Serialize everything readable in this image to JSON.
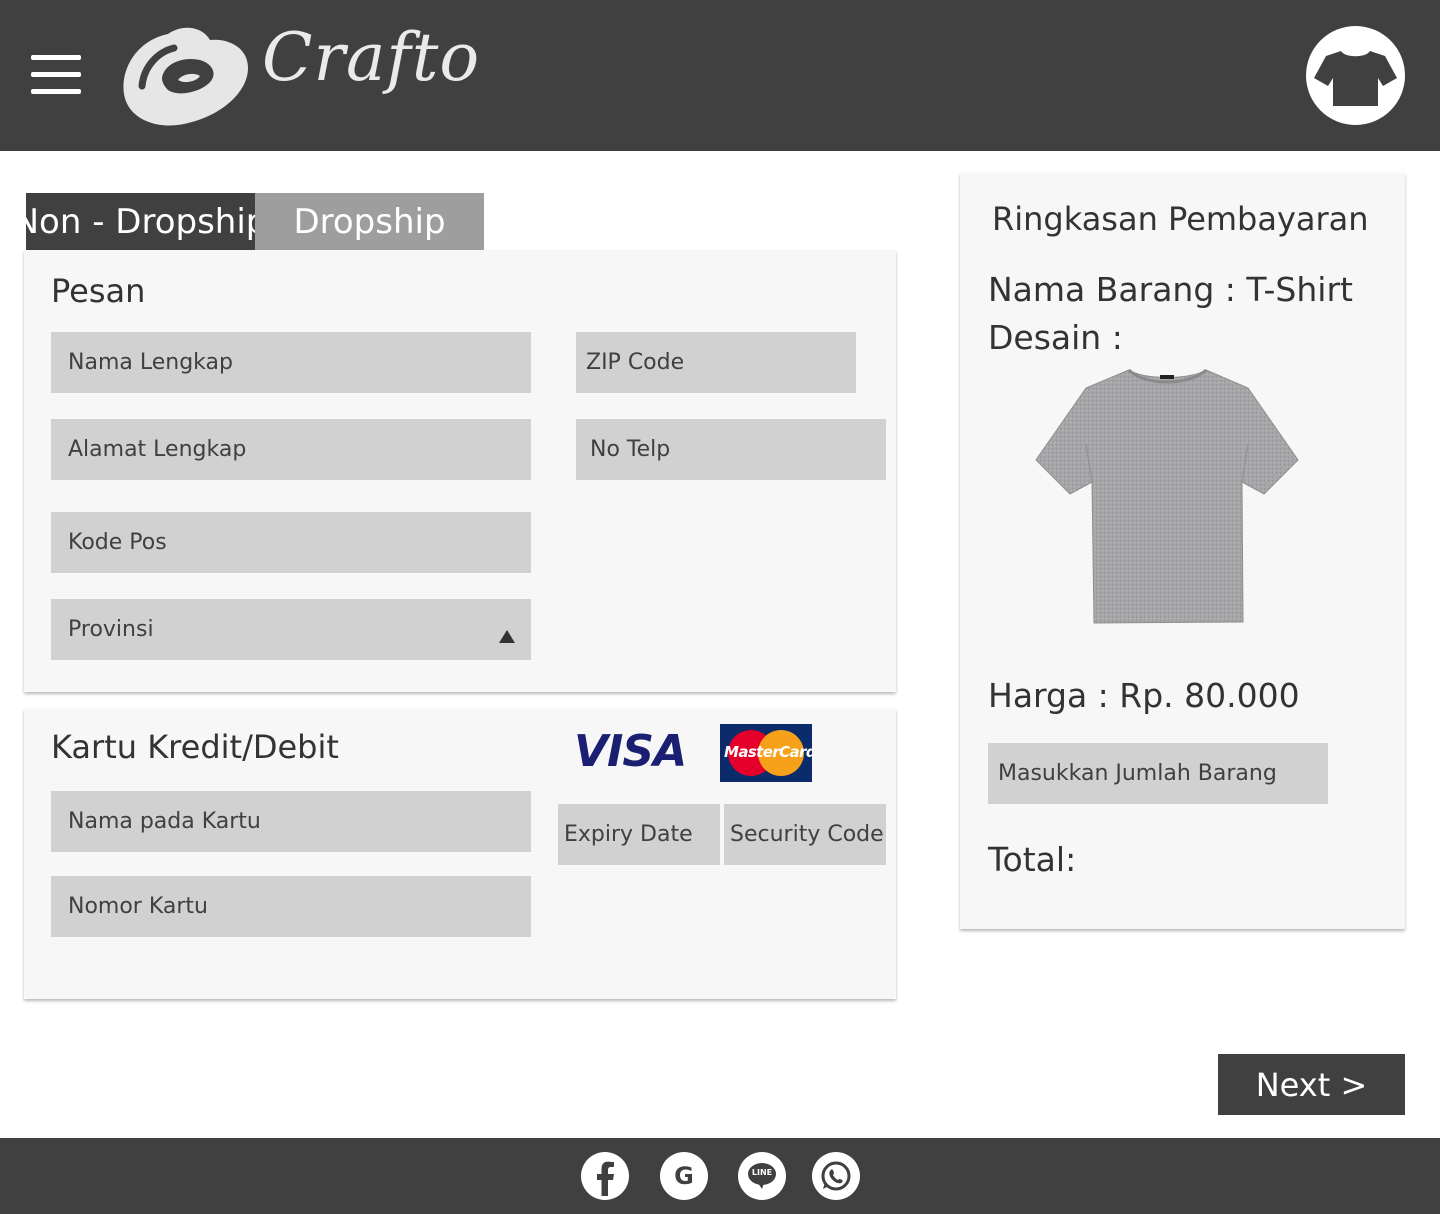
{
  "header": {
    "brand": "Crafto",
    "menu_icon": "hamburger-menu-icon",
    "account_icon": "tshirt-icon"
  },
  "tabs": [
    {
      "label": "Non - Dropship",
      "active": true
    },
    {
      "label": "Dropship",
      "active": false
    }
  ],
  "pesan": {
    "title": "Pesan",
    "fields": {
      "nama_lengkap": "Nama Lengkap",
      "zip_code": "ZIP Code",
      "alamat_lengkap": "Alamat Lengkap",
      "no_telp": "No Telp",
      "kode_pos": "Kode Pos",
      "provinsi": "Provinsi"
    }
  },
  "kartu": {
    "title": "Kartu Kredit/Debit",
    "brands": {
      "visa": "VISA",
      "mastercard": "MasterCard"
    },
    "fields": {
      "nama_pada_kartu": "Nama pada Kartu",
      "nomor_kartu": "Nomor Kartu",
      "expiry_date": "Expiry Date",
      "security_code": "Security Code"
    }
  },
  "summary": {
    "title": "Ringkasan Pembayaran",
    "nama_barang": "Nama Barang : T-Shirt",
    "desain": "Desain :",
    "harga": "Harga : Rp. 80.000",
    "jumlah_placeholder": "Masukkan Jumlah Barang",
    "total": "Total:"
  },
  "actions": {
    "next": "Next >"
  },
  "footer": {
    "social": [
      "facebook-icon",
      "google-icon",
      "line-icon",
      "whatsapp-icon"
    ],
    "google_glyph": "G",
    "line_glyph": "LINE"
  },
  "colors": {
    "header_bg": "#404040",
    "tab_inactive": "#9e9e9e",
    "field_bg": "#d1d1d1",
    "card_bg": "#f7f7f7",
    "visa_blue": "#1a1f71",
    "mastercard_red": "#e4002b",
    "mastercard_orange": "#f7a11a"
  }
}
